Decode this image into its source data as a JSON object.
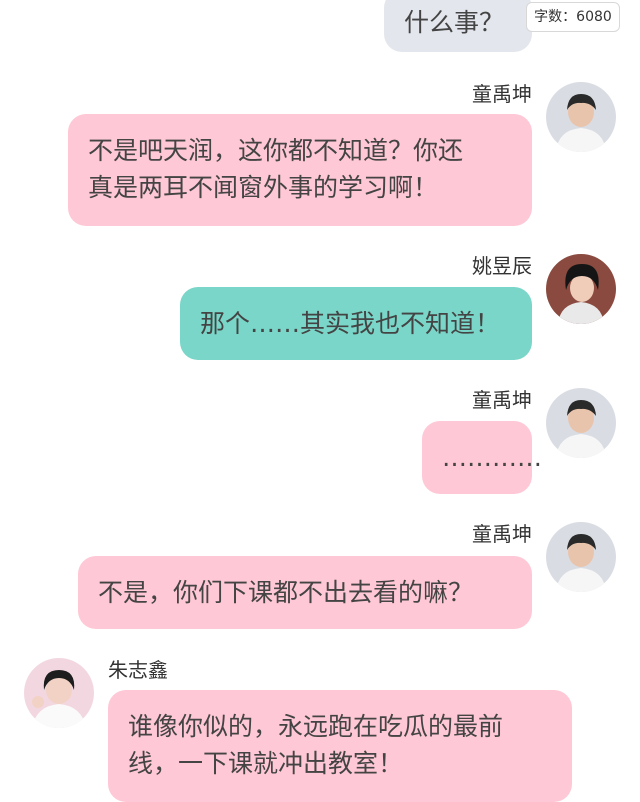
{
  "word_count": "字数：6080",
  "messages": [
    {
      "side": "right",
      "sender": "",
      "text": "什么事？",
      "color": "grey"
    },
    {
      "side": "right",
      "sender": "童禹坤",
      "lines": [
        "不是吧天润，这你都不知道？你还",
        "真是两耳不闻窗外事的学习啊！"
      ],
      "color": "pink"
    },
    {
      "side": "right",
      "sender": "姚昱辰",
      "text": "那个……其实我也不知道！",
      "color": "teal"
    },
    {
      "side": "right",
      "sender": "童禹坤",
      "text": "…………",
      "color": "pink"
    },
    {
      "side": "right",
      "sender": "童禹坤",
      "text": "不是，你们下课都不出去看的嘛？",
      "color": "pink"
    },
    {
      "side": "left",
      "sender": "朱志鑫",
      "lines": [
        "谁像你似的，永远跑在吃瓜的最前",
        "线，一下课就冲出教室！"
      ],
      "color": "pink"
    }
  ],
  "colors": {
    "pink": "#ffc8d6",
    "teal": "#79d6c8",
    "grey": "#e3e6ec"
  },
  "icons": {
    "avatar": "user-avatar-photo"
  }
}
